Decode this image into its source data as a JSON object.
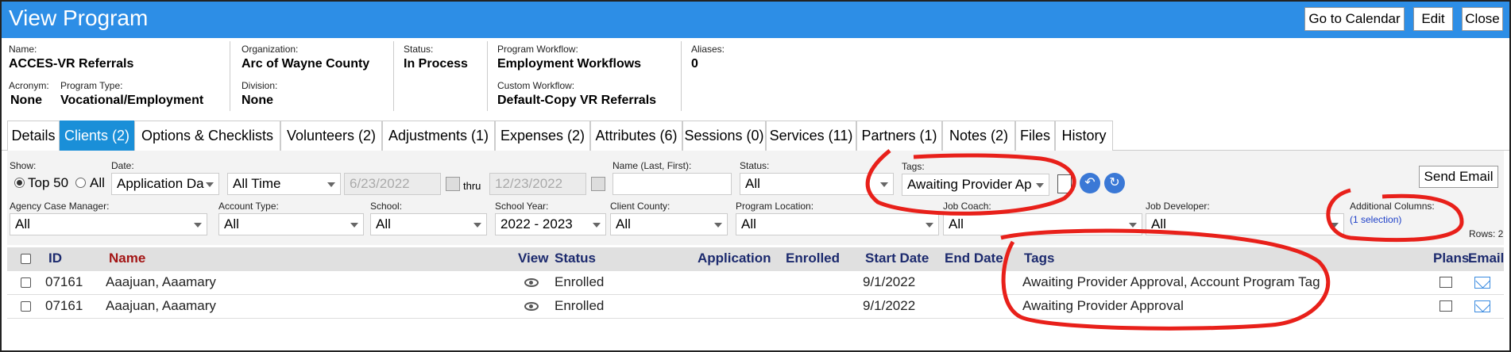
{
  "header": {
    "title": "View Program",
    "buttons": [
      "Go to Calendar",
      "Edit",
      "Close"
    ]
  },
  "info": {
    "name_label": "Name:",
    "name": "ACCES-VR Referrals",
    "acronym_label": "Acronym:",
    "acronym": "None",
    "program_type_label": "Program Type:",
    "program_type": "Vocational/Employment",
    "organization_label": "Organization:",
    "organization": "Arc of Wayne County",
    "division_label": "Division:",
    "division": "None",
    "status_label": "Status:",
    "status": "In Process",
    "workflow_label": "Program Workflow:",
    "workflow": "Employment Workflows",
    "custom_workflow_label": "Custom Workflow:",
    "custom_workflow": "Default-Copy VR Referrals",
    "aliases_label": "Aliases:",
    "aliases": "0"
  },
  "tabs": [
    "Details",
    "Clients (2)",
    "Options & Checklists",
    "Volunteers (2)",
    "Adjustments (1)",
    "Expenses (2)",
    "Attributes (6)",
    "Sessions (0)",
    "Services (11)",
    "Partners (1)",
    "Notes (2)",
    "Files",
    "History"
  ],
  "active_tab": "Clients (2)",
  "filters": {
    "show_label": "Show:",
    "top50": "Top 50",
    "all": "All",
    "date_label": "Date:",
    "date_type": "Application Da",
    "date_range": "All Time",
    "date_from": "6/23/2022",
    "thru": "thru",
    "date_to": "12/23/2022",
    "name_label": "Name (Last, First):",
    "name_value": "",
    "status_label": "Status:",
    "status_value": "All",
    "tags_label": "Tags:",
    "tags_value": "Awaiting Provider Ap",
    "send_email": "Send Email",
    "agency_label": "Agency Case Manager:",
    "agency_value": "All",
    "account_label": "Account Type:",
    "account_value": "All",
    "school_label": "School:",
    "school_value": "All",
    "year_label": "School Year:",
    "year_value": "2022 - 2023",
    "county_label": "Client County:",
    "county_value": "All",
    "location_label": "Program Location:",
    "location_value": "All",
    "coach_label": "Job Coach:",
    "coach_value": "All",
    "developer_label": "Job Developer:",
    "developer_value": "All",
    "addcols_label": "Additional Columns:",
    "addcols_value": "(1 selection)",
    "rows": "Rows: 2"
  },
  "table": {
    "headers": {
      "id": "ID",
      "name": "Name",
      "view": "View",
      "status": "Status",
      "application": "Application",
      "enrolled": "Enrolled",
      "start": "Start Date",
      "end": "End Date",
      "tags": "Tags",
      "plans": "Plans",
      "email": "Email"
    },
    "rows": [
      {
        "id": "07161",
        "name": "Aaajuan, Aaamary",
        "status": "Enrolled",
        "start": "9/1/2022",
        "tags": "Awaiting Provider Approval, Account Program Tag"
      },
      {
        "id": "07161",
        "name": "Aaajuan, Aaamary",
        "status": "Enrolled",
        "start": "9/1/2022",
        "tags": "Awaiting Provider Approval"
      }
    ]
  },
  "colors": {
    "title_bar": "#2d8ee6",
    "active_tab": "#1a8fd8",
    "annotation": "#e8201a"
  }
}
